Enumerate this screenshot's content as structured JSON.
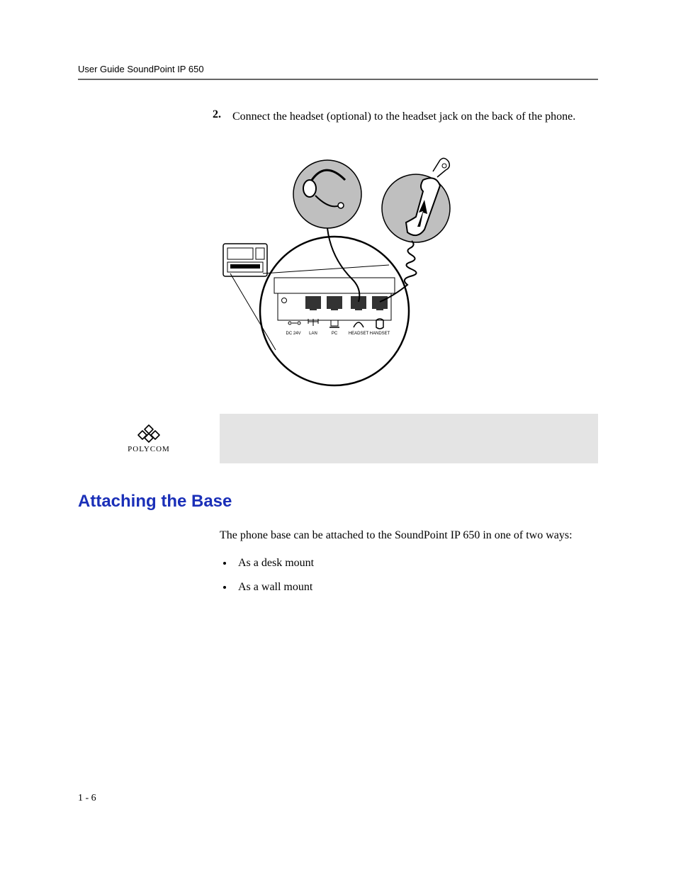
{
  "header": {
    "running_head": "User Guide SoundPoint IP 650"
  },
  "step": {
    "number": "2.",
    "text": "Connect the headset (optional) to the headset jack on the back of the phone."
  },
  "figure": {
    "ports": {
      "dc": "DC 24V",
      "lan": "LAN",
      "pc": "PC",
      "headset": "HEADSET",
      "handset": "HANDSET"
    }
  },
  "logo": {
    "brand": "POLYCOM"
  },
  "section": {
    "heading": "Attaching the Base",
    "intro": "The phone base can be attached to the SoundPoint IP 650 in one of two ways:",
    "bullets": [
      "As a desk mount",
      "As a wall mount"
    ]
  },
  "footer": {
    "page": "1 - 6"
  }
}
